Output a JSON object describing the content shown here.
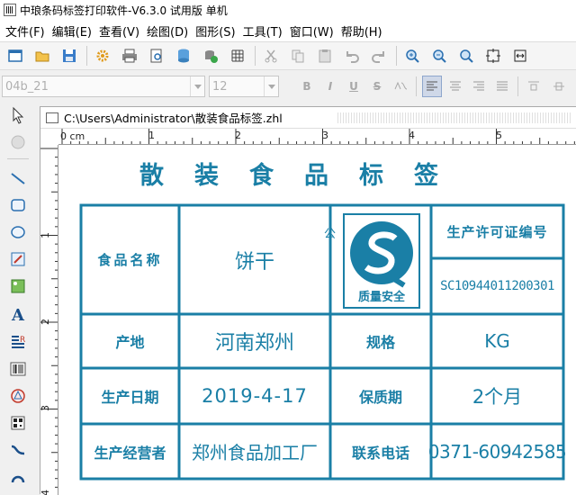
{
  "window": {
    "title": "中琅条码标签打印软件-V6.3.0 试用版 单机"
  },
  "menu": [
    "文件(F)",
    "编辑(E)",
    "查看(V)",
    "绘图(D)",
    "图形(S)",
    "工具(T)",
    "窗口(W)",
    "帮助(H)"
  ],
  "toolbar": {
    "icons": [
      "new-icon",
      "open-icon",
      "save-icon",
      "settings-icon",
      "print-icon",
      "preview-icon",
      "database-icon",
      "db-connect-icon",
      "grid-icon",
      "cut-icon",
      "copy-icon",
      "paste-icon",
      "undo-icon",
      "redo-icon",
      "zoom-in-icon",
      "zoom-out-icon",
      "zoom-fit-icon",
      "fit-page-icon",
      "fit-width-icon"
    ]
  },
  "format_bar": {
    "font_name": "04b_21",
    "font_size": "12",
    "bold": "B",
    "italic": "I",
    "underline": "U",
    "strike": "S"
  },
  "document": {
    "path": "C:\\Users\\Administrator\\散装食品标签.zhl"
  },
  "ruler": {
    "h_unit": "0 cm",
    "h_ticks": [
      "1",
      "2",
      "3",
      "4",
      "5"
    ],
    "v_ticks": [
      "1",
      "2",
      "3",
      "4"
    ]
  },
  "label": {
    "title": "散装食品标签",
    "food_name_label": "食品名称",
    "food_name_value": "饼干",
    "logo_text": "质量安全",
    "license_label": "生产许可证编号",
    "license_value": "SC10944011200301",
    "origin_label": "产地",
    "origin_value": "河南郑州",
    "spec_label": "规格",
    "spec_value": "KG",
    "date_label": "生产日期",
    "date_value": "2019-4-17",
    "shelf_label": "保质期",
    "shelf_value": "2个月",
    "producer_label": "生产经营者",
    "producer_value": "郑州食品加工厂",
    "phone_label": "联系电话",
    "phone_value": "0371-60942585",
    "stray_text": "公"
  },
  "colors": {
    "label_blue": "#1a7fa6",
    "active_align": "#cfd8e8"
  }
}
